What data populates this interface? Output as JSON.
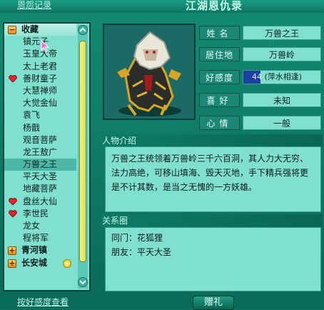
{
  "window": {
    "title": "江湖恩仇录",
    "top_link": "恩怨记录"
  },
  "list": [
    {
      "label": "收藏",
      "type": "group",
      "icon": "minus-icon"
    },
    {
      "label": "镇元子",
      "type": "item"
    },
    {
      "label": "玉皇大帝",
      "type": "item"
    },
    {
      "label": "太上老君",
      "type": "item"
    },
    {
      "label": "善财童子",
      "type": "item",
      "icon": "heart-icon"
    },
    {
      "label": "大慧禅师",
      "type": "item"
    },
    {
      "label": "大觉金仙",
      "type": "item"
    },
    {
      "label": "袁飞",
      "type": "item"
    },
    {
      "label": "杨戬",
      "type": "item"
    },
    {
      "label": "观音菩萨",
      "type": "item"
    },
    {
      "label": "龙王敖广",
      "type": "item"
    },
    {
      "label": "万兽之王",
      "type": "item",
      "selected": true
    },
    {
      "label": "平天大圣",
      "type": "item"
    },
    {
      "label": "地藏菩萨",
      "type": "item"
    },
    {
      "label": "盘丝大仙",
      "type": "item",
      "icon": "heart-icon"
    },
    {
      "label": "李世民",
      "type": "item",
      "icon": "heart-icon"
    },
    {
      "label": "龙女",
      "type": "item"
    },
    {
      "label": "程将军",
      "type": "item"
    },
    {
      "label": "青河镇",
      "type": "group",
      "icon": "plus-icon"
    },
    {
      "label": "长安城",
      "type": "group",
      "icon": "plus-icon",
      "coin": true
    }
  ],
  "bottom_link": "按好感度查看",
  "info": {
    "name_label": "姓名",
    "name": "万兽之王",
    "home_label": "居住地",
    "home": "万兽岭",
    "fav_label": "好感度",
    "fav_value": "44",
    "fav_desc": "(萍水相逢)",
    "fav_fraction": 0.22,
    "hobby_label": "喜好",
    "hobby": "未知",
    "mood_label": "心情",
    "mood": "一般"
  },
  "intro": {
    "title": "人物介绍",
    "text": "万兽之王统领着万兽岭三千六百洞，其人力大无穷、法力高绝，可移山填海、毁天灭地，手下精兵强将更是不计其数，是当之无愧的一方妖雄。"
  },
  "relations": {
    "title": "关系圈",
    "lines": [
      "同门：花狐狸",
      "朋友：平天大圣"
    ]
  },
  "gift_button": "赠礼",
  "colors": {
    "accent": "#0c6f5a",
    "panel": "#7fe0cf",
    "selected": "#4bb8a7",
    "fav_bar": "#1c3fa2"
  }
}
